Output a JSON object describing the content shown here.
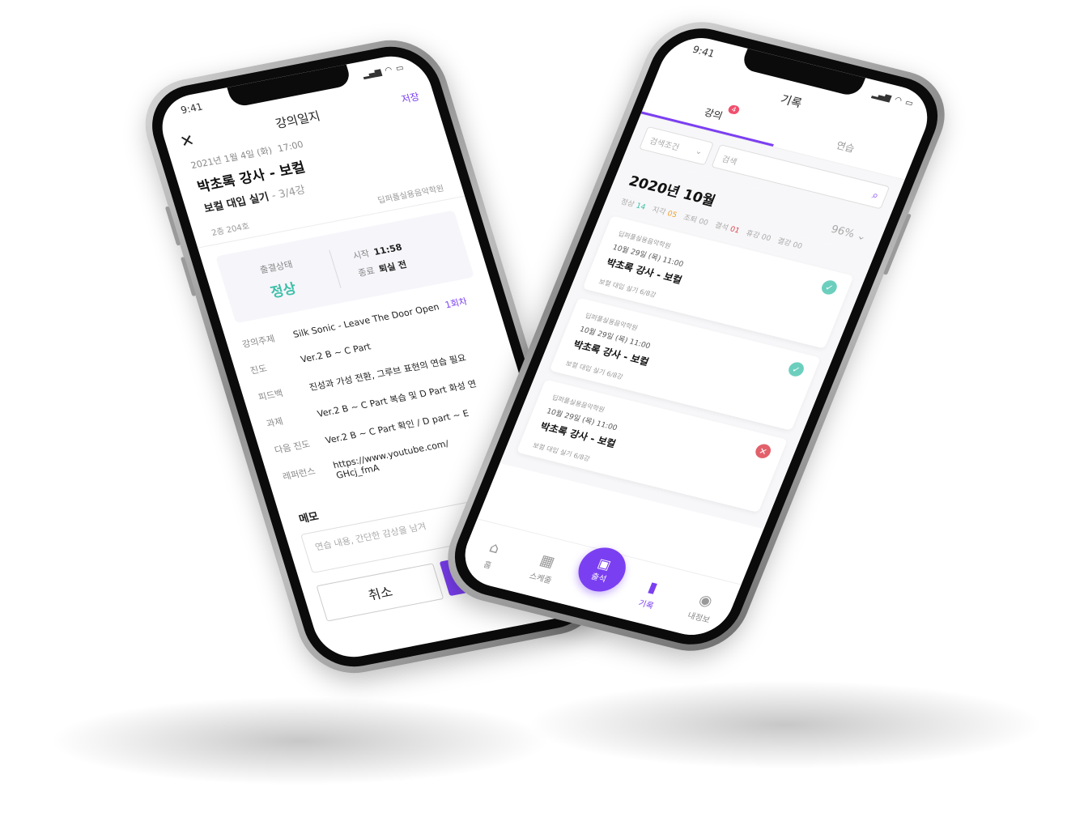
{
  "left_screen": {
    "status_time": "9:41",
    "close_label": "✕",
    "title": "강의일지",
    "header_save": "저장",
    "date": "2021년 1월 4일 (화)",
    "time": "17:00",
    "lecture": "박초록 강사 - 보컬",
    "course": "보컬 대입 실기",
    "round": " - 3/4강",
    "room": "2층 204호",
    "academy": "딥퍼플실용음악학원",
    "attendance": {
      "label": "출결상태",
      "value": "정상",
      "start_label": "시작",
      "start_value": "11:58",
      "end_label": "종료",
      "end_value": "퇴실 전"
    },
    "info_rows": [
      {
        "key": "강의주제",
        "value": "Silk Sonic - Leave The Door Open",
        "badge": "1회차"
      },
      {
        "key": "진도",
        "value": "Ver.2 B ~ C Part"
      },
      {
        "key": "피드백",
        "value": "진성과 가성 전환, 그루브 표현의 연습 필요"
      },
      {
        "key": "과제",
        "value": "Ver.2 B ~ C Part 복습 및 D Part 화성 연"
      },
      {
        "key": "다음 진도",
        "value": "Ver.2 B ~ C Part 확인 / D part ~ E"
      },
      {
        "key": "레퍼런스",
        "value": "https://www.youtube.com/",
        "value2": "GHcj_fmA"
      }
    ],
    "memo_title": "메모",
    "memo_placeholder": "연습 내용, 간단한 감상을 남겨",
    "cancel": "취소",
    "save": "저장"
  },
  "right_screen": {
    "status_time": "9:41",
    "title": "기록",
    "tabs": [
      {
        "label": "강의",
        "count": "4"
      },
      {
        "label": "연습"
      }
    ],
    "filter_placeholder": "검색조건",
    "search_placeholder": "검색",
    "month": "2020년 10월",
    "percent": "96%",
    "stats": [
      {
        "label": "정상",
        "value": "14"
      },
      {
        "label": "지각",
        "value": "05"
      },
      {
        "label": "조퇴",
        "value": "00"
      },
      {
        "label": "결석",
        "value": "01"
      },
      {
        "label": "휴강",
        "value": "00"
      },
      {
        "label": "결강",
        "value": "00"
      }
    ],
    "records": [
      {
        "academy": "딥퍼플실용음악학원",
        "datetime": "10월 29일 (목)  11:00",
        "lecture": "박초록 강사 - 보컬",
        "course": "보컬 대입 실기 6/8강",
        "status": "✓"
      },
      {
        "academy": "딥퍼플실용음악학원",
        "datetime": "10월 29일 (목)  11:00",
        "lecture": "박초록 강사 - 보컬",
        "course": "보컬 대입 실기 6/8강",
        "status": "✓"
      },
      {
        "academy": "딥퍼플실용음악학원",
        "datetime": "10월 29일 (목)  11:00",
        "lecture": "박초록 강사 - 보컬",
        "course": "보컬 대입 실기 6/8강",
        "status": "✕"
      }
    ],
    "nav": {
      "home": "홈",
      "schedule": "스케줄",
      "attend": "출석",
      "record": "기록",
      "profile": "내정보"
    }
  }
}
